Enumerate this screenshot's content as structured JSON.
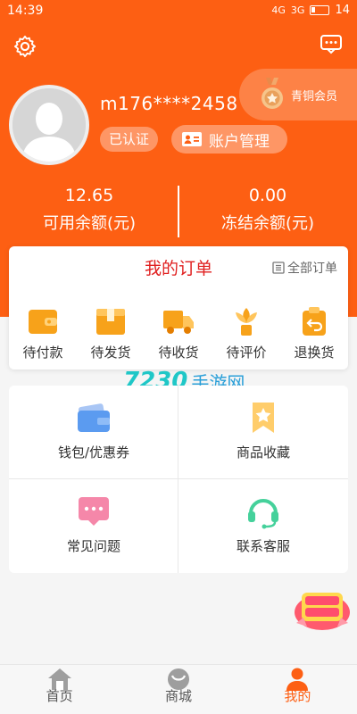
{
  "status_bar": {
    "time": "14:39",
    "network_a": "4G",
    "network_b": "3G",
    "battery": "14"
  },
  "colors": {
    "brand": "#fd5f13",
    "order_title": "#e02020",
    "watermark": "#1fc7c7"
  },
  "user": {
    "username": "m176****2458",
    "verified_label": "已认证",
    "account_button": "账户管理",
    "member_level": "青铜会员"
  },
  "balances": {
    "available_value": "12.65",
    "available_label": "可用余额(元)",
    "frozen_value": "0.00",
    "frozen_label": "冻结余额(元)"
  },
  "orders": {
    "title": "我的订单",
    "all_label": "全部订单",
    "items": [
      {
        "label": "待付款",
        "icon": "wallet-icon"
      },
      {
        "label": "待发货",
        "icon": "package-icon"
      },
      {
        "label": "待收货",
        "icon": "truck-icon"
      },
      {
        "label": "待评价",
        "icon": "flower-icon"
      },
      {
        "label": "退换货",
        "icon": "return-icon"
      }
    ]
  },
  "services": [
    {
      "label": "钱包/优惠券",
      "icon": "wallet-card-icon"
    },
    {
      "label": "商品收藏",
      "icon": "bookmark-star-icon"
    },
    {
      "label": "常见问题",
      "icon": "chat-bubble-icon"
    },
    {
      "label": "联系客服",
      "icon": "headset-icon"
    }
  ],
  "watermark": {
    "number": "7230",
    "text": "手游网"
  },
  "tabbar": [
    {
      "label": "首页",
      "icon": "home-icon"
    },
    {
      "label": "商城",
      "icon": "shop-icon"
    },
    {
      "label": "我的",
      "icon": "profile-icon",
      "active": true
    }
  ]
}
